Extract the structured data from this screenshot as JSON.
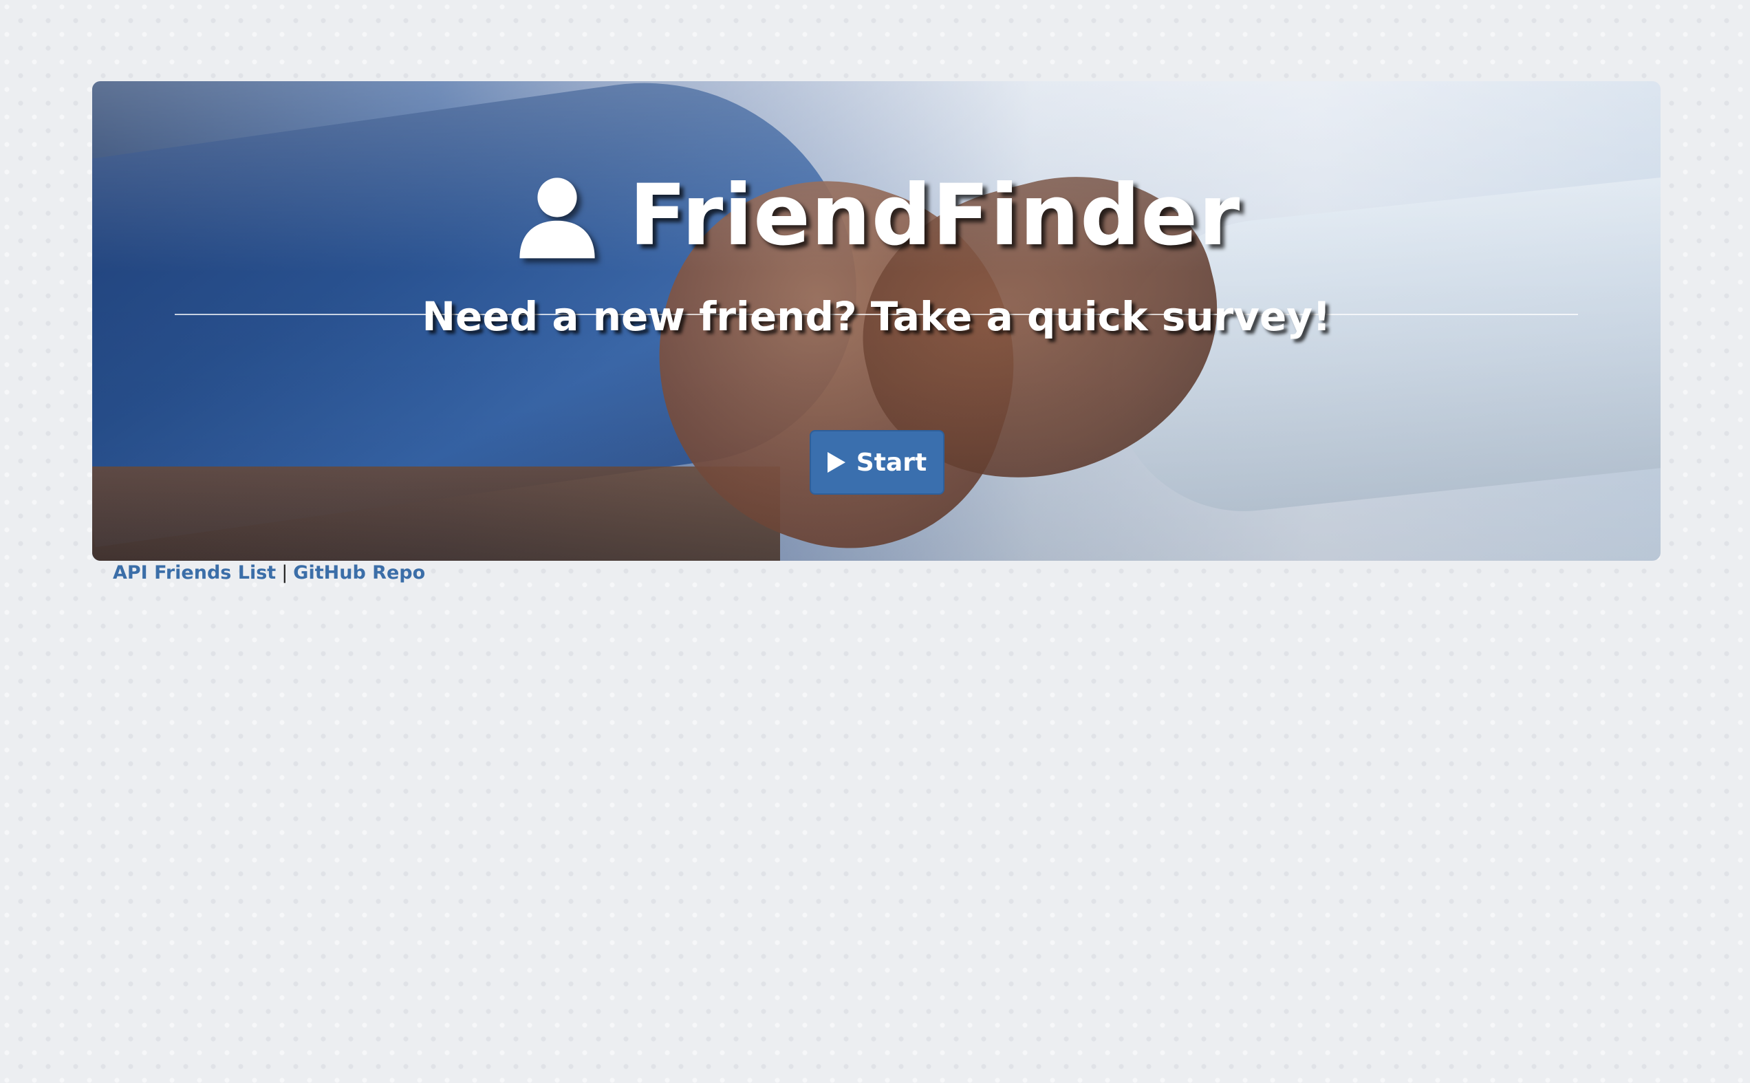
{
  "hero": {
    "title": "FriendFinder",
    "title_icon": "user-icon",
    "subtitle": "Need a new friend? Take a quick survey!",
    "start_button": {
      "icon": "play-icon",
      "label": "Start"
    }
  },
  "footer": {
    "links": [
      {
        "label": "API Friends List"
      },
      {
        "label": "GitHub Repo"
      }
    ],
    "separator": "|"
  },
  "colors": {
    "accent": "#3a6fae",
    "link": "#3b6ea8",
    "background": "#eceef1"
  }
}
